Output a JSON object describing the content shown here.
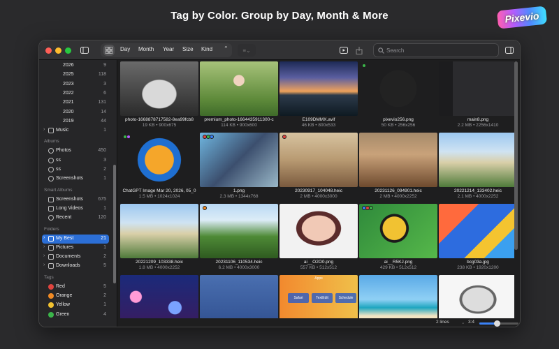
{
  "banner": {
    "headline": "Tag by Color. Group by Day, Month & More",
    "logo_text": "Pixevio"
  },
  "toolbar": {
    "group_options": [
      "Day",
      "Month",
      "Year",
      "Size",
      "Kind"
    ],
    "search_placeholder": "Search"
  },
  "sidebar": {
    "years": [
      {
        "label": "2026",
        "count": "9"
      },
      {
        "label": "2025",
        "count": "118"
      },
      {
        "label": "2023",
        "count": "3"
      },
      {
        "label": "2022",
        "count": "6"
      },
      {
        "label": "2021",
        "count": "131"
      },
      {
        "label": "2020",
        "count": "14"
      },
      {
        "label": "2019",
        "count": "44"
      }
    ],
    "music": {
      "label": "Music",
      "count": "1"
    },
    "albums_title": "Albums",
    "albums": [
      {
        "label": "Photos",
        "count": "450"
      },
      {
        "label": "ss",
        "count": "3"
      },
      {
        "label": "ss",
        "count": "2"
      },
      {
        "label": "Screenshots",
        "count": "1"
      }
    ],
    "smart_title": "Smart Albums",
    "smart": [
      {
        "label": "Screenshots",
        "count": "675"
      },
      {
        "label": "Long Videos",
        "count": "1"
      },
      {
        "label": "Recent",
        "count": "120"
      }
    ],
    "folders_title": "Folders",
    "folders": [
      {
        "label": "My Best",
        "count": "21",
        "selected": true
      },
      {
        "label": "Pictures",
        "count": "1"
      },
      {
        "label": "Documents",
        "count": "2"
      },
      {
        "label": "Downloads",
        "count": "5"
      }
    ],
    "tags_title": "Tags",
    "tags": [
      {
        "label": "Red",
        "count": "5",
        "color": "#e0443e"
      },
      {
        "label": "Orange",
        "count": "2",
        "color": "#f08a24"
      },
      {
        "label": "Yellow",
        "count": "1",
        "color": "#f2c230"
      },
      {
        "label": "Green",
        "count": "4",
        "color": "#3bb54a"
      }
    ]
  },
  "files": [
    {
      "name": "photo-1668878717582-8ea99fcb8",
      "meta": "19 KB • 900x675",
      "icon": "car-photo",
      "tags": []
    },
    {
      "name": "premium_photo-1664435911300-c",
      "meta": "114 KB • 900x600",
      "icon": "woman-photo",
      "tags": []
    },
    {
      "name": "E109DMMX.avif",
      "meta": "46 KB • 800x533",
      "icon": "sunset-photo",
      "tags": []
    },
    {
      "name": "pixevio256.png",
      "meta": "50 KB • 256x256",
      "icon": "app-icon",
      "tags": [
        "#3bb54a"
      ]
    },
    {
      "name": "main8.png",
      "meta": "2.2 MB • 2256x1410",
      "icon": "screenshot",
      "tags": []
    },
    {
      "name": "ChatGPT Image Mar 20, 2026, 05_0",
      "meta": "1.5 MB • 1024x1024",
      "icon": "mountain-logo",
      "tags": [
        "#3bb54a",
        "#b45cff"
      ]
    },
    {
      "name": "1.png",
      "meta": "2.3 MB • 1344x768",
      "icon": "photo-collage",
      "tags": [
        "#e0443e",
        "#3bb54a",
        "#3b82f6"
      ]
    },
    {
      "name": "20230917_104048.heic",
      "meta": "2 MB • 4000x3000",
      "icon": "living-room",
      "tags": [
        "#e0443e"
      ]
    },
    {
      "name": "20231126_094901.heic",
      "meta": "2 MB • 4000x2252",
      "icon": "market-photo",
      "tags": []
    },
    {
      "name": "20221214_133402.heic",
      "meta": "2.1 MB • 4000x2252",
      "icon": "house-photo",
      "tags": []
    },
    {
      "name": "20221209_103338.heic",
      "meta": "1.8 MB • 4000x2252",
      "icon": "house-photo",
      "tags": []
    },
    {
      "name": "20231106_110534.heic",
      "meta": "6.2 MB • 4000x3000",
      "icon": "garden-photo",
      "tags": [
        "#f08a24"
      ]
    },
    {
      "name": "ai__O2O0.png",
      "meta": "557 KB • 512x512",
      "icon": "portrait-photo",
      "tags": []
    },
    {
      "name": "ai__R5KJ.png",
      "meta": "429 KB • 512x512",
      "icon": "magnifier-doc",
      "tags": [
        "#3b82f6",
        "#e0443e",
        "#3bb54a"
      ]
    },
    {
      "name": "bcg03a.jpg",
      "meta": "238 KB • 1920x1200",
      "icon": "wallpaper",
      "tags": []
    },
    {
      "name": "",
      "meta": "",
      "icon": "bokeh",
      "tags": []
    },
    {
      "name": "",
      "meta": "",
      "icon": "ios-screen",
      "tags": []
    },
    {
      "name": "",
      "meta": "",
      "icon": "app-switcher",
      "tags": [],
      "label_top": "Apps",
      "labels": [
        "Safari",
        "TextEdit",
        "Schedule"
      ]
    },
    {
      "name": "",
      "meta": "",
      "icon": "beach",
      "tags": []
    },
    {
      "name": "",
      "meta": "",
      "icon": "sketch-portrait",
      "tags": []
    }
  ],
  "status": {
    "lines": "2 lines",
    "ratio": "3:4",
    "zoom_level": 0.45
  }
}
